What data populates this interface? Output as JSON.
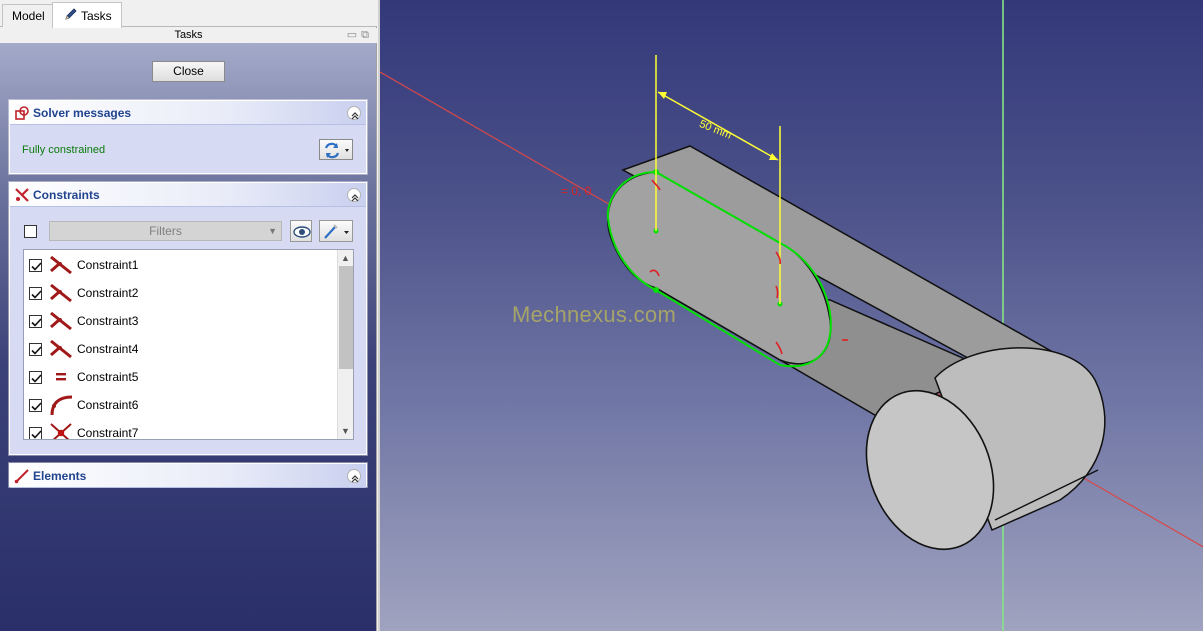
{
  "tabs": [
    {
      "label": "Model"
    },
    {
      "label": "Tasks"
    }
  ],
  "tasks_header": {
    "title": "Tasks"
  },
  "close_label": "Close",
  "solver": {
    "title": "Solver messages",
    "status": "Fully constrained"
  },
  "constraints": {
    "title": "Constraints",
    "filter_placeholder": "Filters",
    "items": [
      {
        "label": "Constraint1",
        "checked": true,
        "icon": "perpendicular-constraint-icon"
      },
      {
        "label": "Constraint2",
        "checked": true,
        "icon": "perpendicular-constraint-icon"
      },
      {
        "label": "Constraint3",
        "checked": true,
        "icon": "perpendicular-constraint-icon"
      },
      {
        "label": "Constraint4",
        "checked": true,
        "icon": "perpendicular-constraint-icon"
      },
      {
        "label": "Constraint5",
        "checked": true,
        "icon": "equal-constraint-icon"
      },
      {
        "label": "Constraint6",
        "checked": true,
        "icon": "tangent-constraint-icon"
      },
      {
        "label": "Constraint7",
        "checked": true,
        "icon": "symmetric-constraint-icon"
      }
    ]
  },
  "elements": {
    "title": "Elements"
  },
  "viewport": {
    "watermark": "Mechnexus.com",
    "dimension_label": "50 mm",
    "angle_label": "= 0, 0"
  },
  "colors": {
    "constrained_green": "#00e000",
    "dimension_yellow": "#ffff00",
    "axis_red": "#e04040",
    "axis_green": "#7fe07f",
    "header_blue": "#21448f"
  }
}
